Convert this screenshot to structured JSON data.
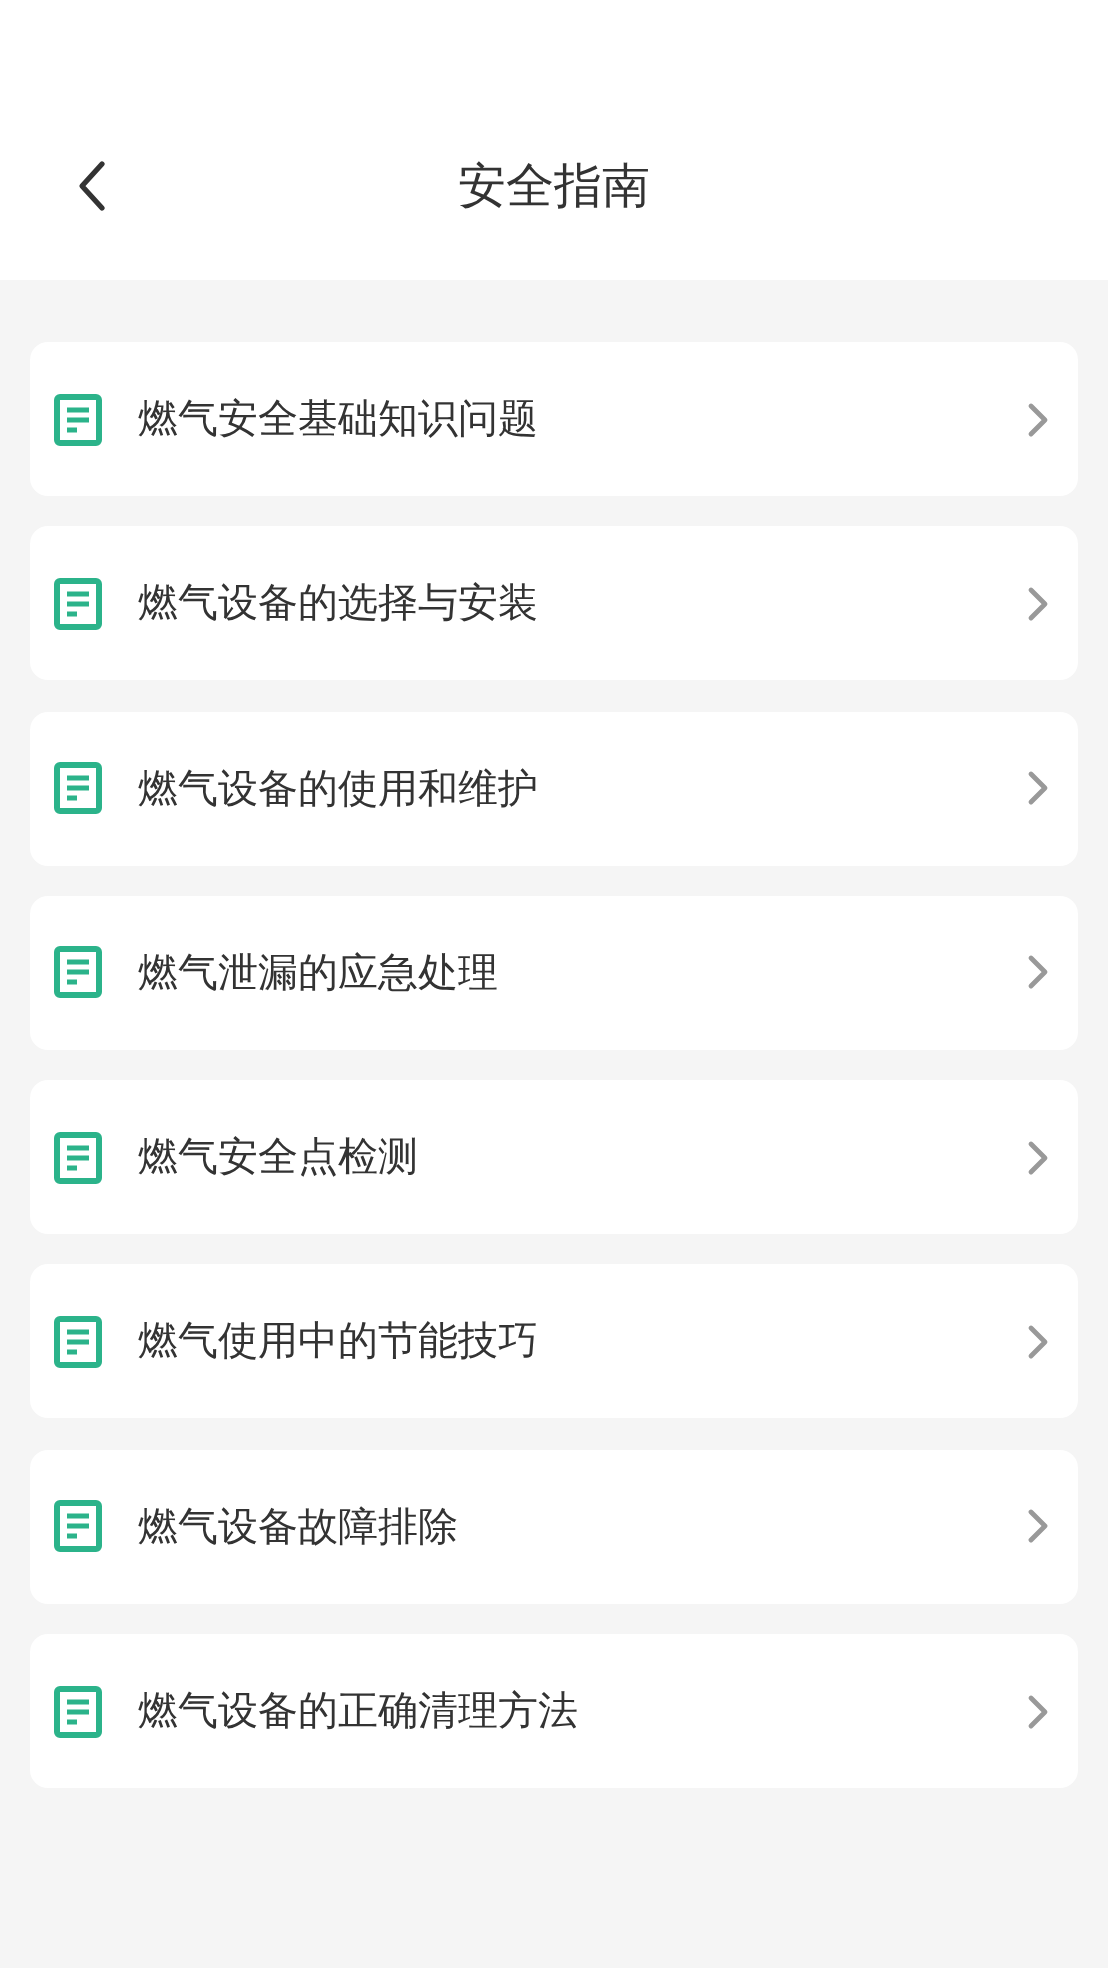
{
  "header": {
    "title": "安全指南"
  },
  "items": [
    {
      "label": "燃气安全基础知识问题"
    },
    {
      "label": "燃气设备的选择与安装"
    },
    {
      "label": "燃气设备的使用和维护"
    },
    {
      "label": "燃气泄漏的应急处理"
    },
    {
      "label": "燃气安全点检测"
    },
    {
      "label": "燃气使用中的节能技巧"
    },
    {
      "label": "燃气设备故障排除"
    },
    {
      "label": "燃气设备的正确清理方法"
    }
  ]
}
